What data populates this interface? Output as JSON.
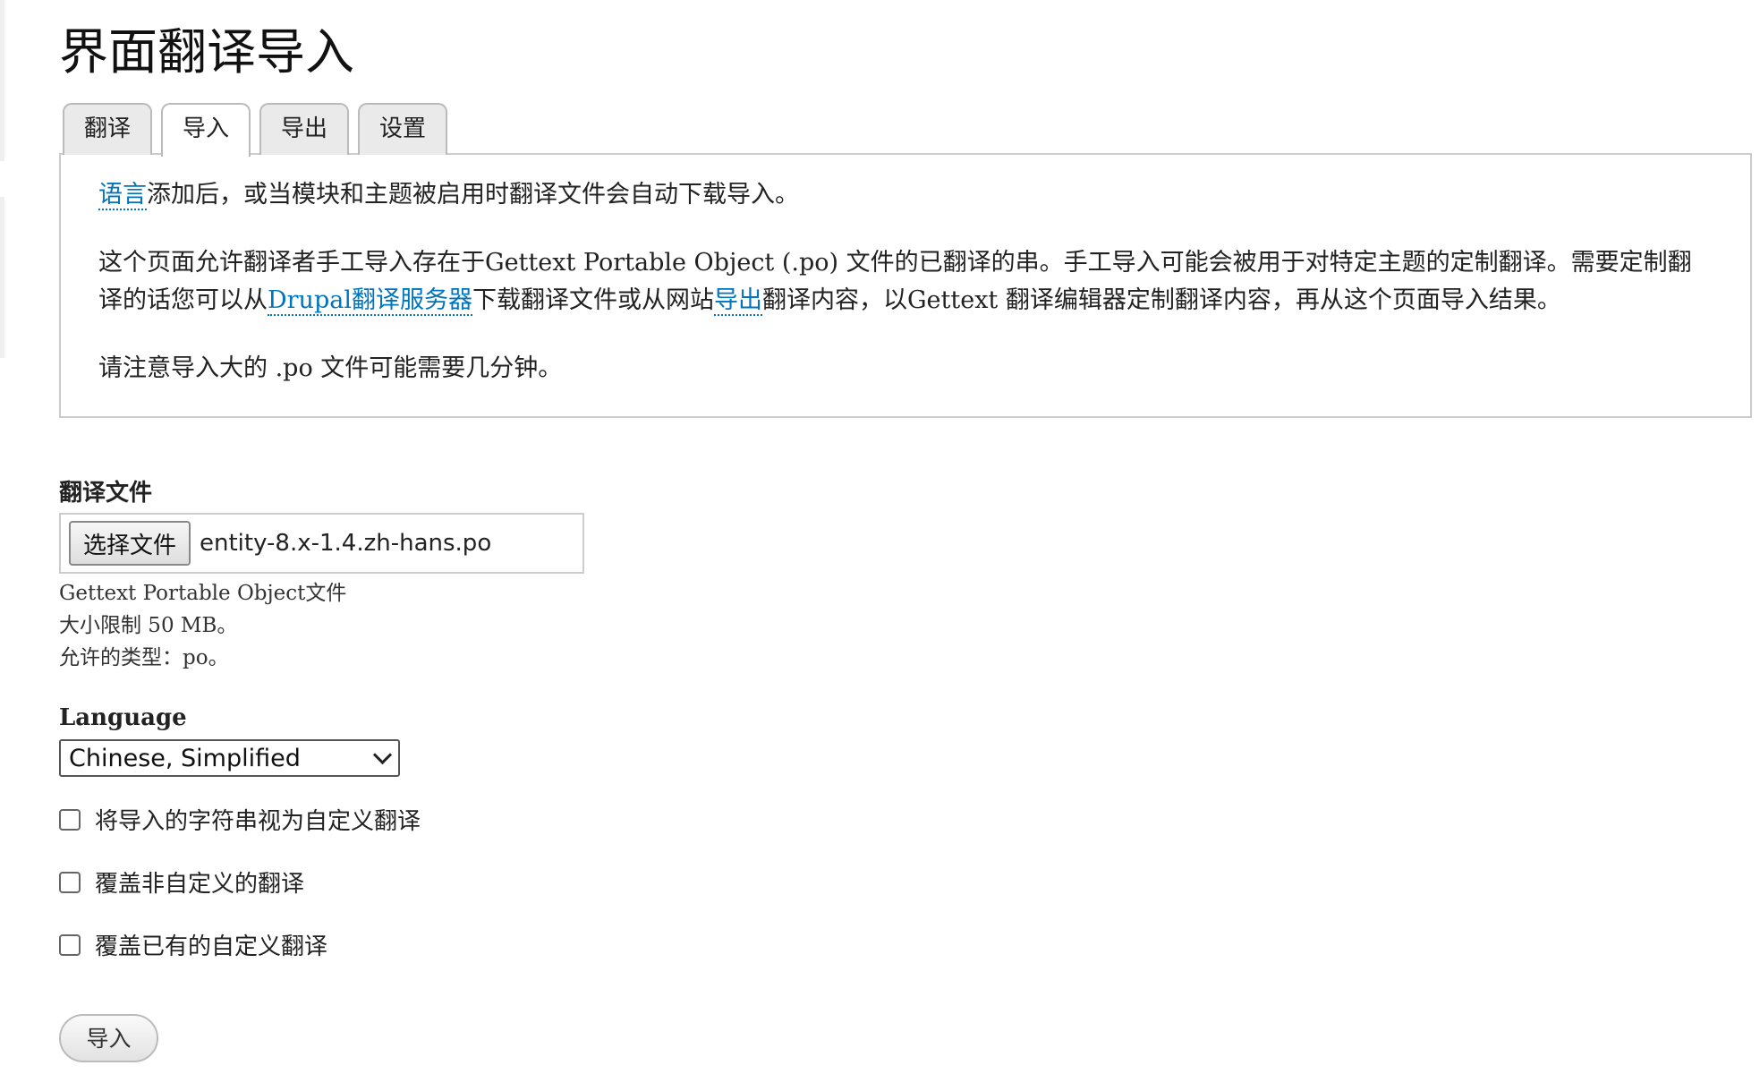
{
  "page": {
    "title": "界面翻译导入"
  },
  "tabs": [
    {
      "label": "翻译",
      "active": false
    },
    {
      "label": "导入",
      "active": true
    },
    {
      "label": "导出",
      "active": false
    },
    {
      "label": "设置",
      "active": false
    }
  ],
  "help": {
    "p1_link": "语言",
    "p1_text": "添加后，或当模块和主题被启用时翻译文件会自动下载导入。",
    "p2_text_a": "这个页面允许翻译者手工导入存在于Gettext Portable Object (.po) 文件的已翻译的串。手工导入可能会被用于对特定主题的定制翻译。需要定制翻译的话您可以从",
    "p2_link_a": "Drupal翻译服务器",
    "p2_text_b": "下载翻译文件或从网站",
    "p2_link_b": "导出",
    "p2_text_c": "翻译内容，以Gettext 翻译编辑器定制翻译内容，再从这个页面导入结果。",
    "p3_text": "请注意导入大的 .po 文件可能需要几分钟。"
  },
  "file_field": {
    "label": "翻译文件",
    "button_label": "选择文件",
    "file_name": "entity-8.x-1.4.zh-hans.po",
    "desc_line1": "Gettext Portable Object文件",
    "desc_line2": "大小限制 50 MB。",
    "desc_line3": "允许的类型：po。"
  },
  "language": {
    "label": "Language",
    "selected": "Chinese, Simplified"
  },
  "options": {
    "customized_label": "将导入的字符串视为自定义翻译",
    "overwrite_noncustom_label": "覆盖非自定义的翻译",
    "overwrite_custom_label": "覆盖已有的自定义翻译"
  },
  "submit": {
    "label": "导入"
  },
  "colors": {
    "link": "#0074bd",
    "border": "#cccccc",
    "tab_bg": "#eaeaea"
  }
}
